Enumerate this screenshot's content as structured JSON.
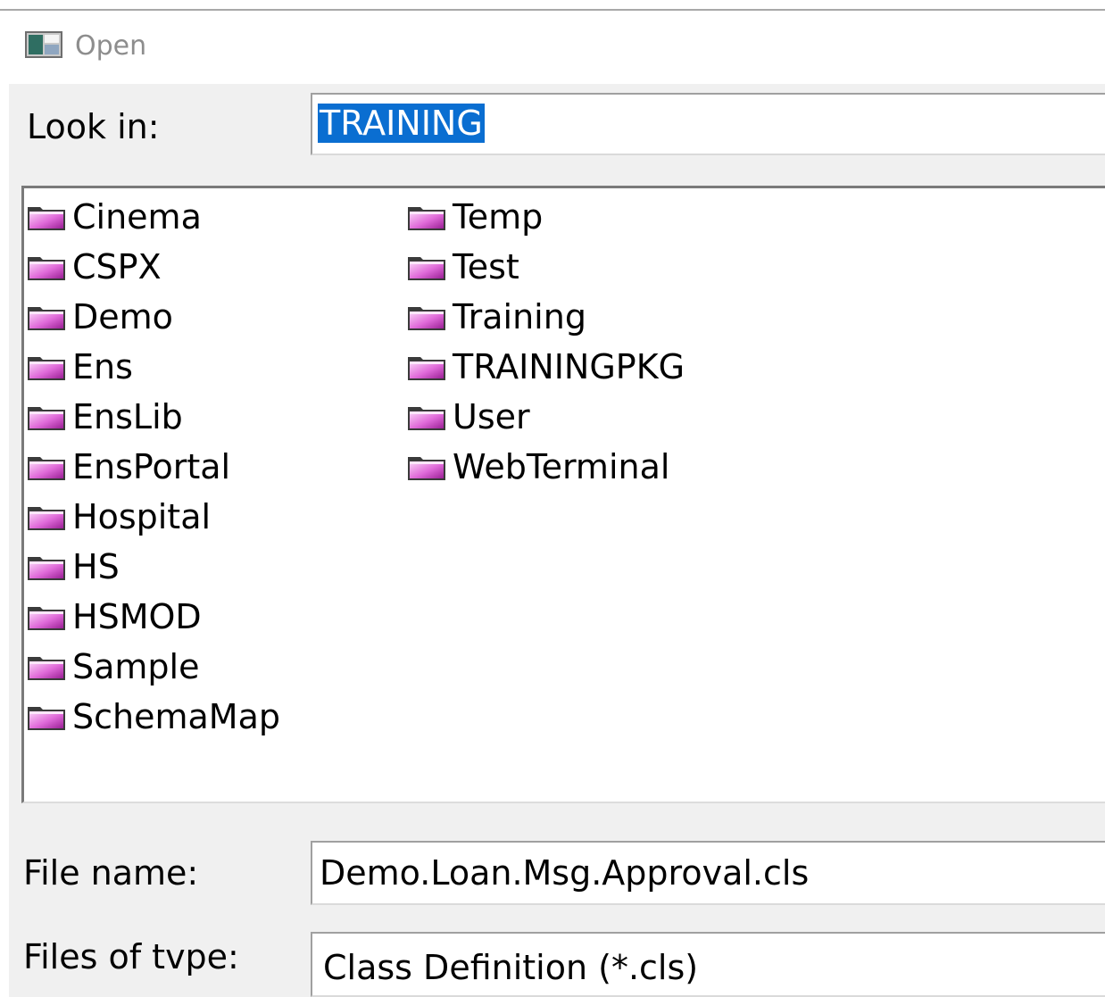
{
  "window": {
    "title": "Open",
    "icon": "window-app-icon"
  },
  "look_in": {
    "label": "Look in:",
    "value": "TRAINING"
  },
  "folders": {
    "column1": [
      "Cinema",
      "CSPX",
      "Demo",
      "Ens",
      "EnsLib",
      "EnsPortal",
      "Hospital",
      "HS",
      "HSMOD",
      "Sample",
      "SchemaMap"
    ],
    "column2": [
      "Temp",
      "Test",
      "Training",
      "TRAININGPKG",
      "User",
      "WebTerminal"
    ],
    "icon": "folder-icon"
  },
  "file_name": {
    "label": "File name:",
    "value": "Demo.Loan.Msg.Approval.cls"
  },
  "files_of_type": {
    "label": "Files of tvpe:",
    "value": "Class Definition (*.cls)"
  },
  "colors": {
    "dialog_background": "#f0f0f0",
    "selection": "#0a6ed1",
    "folder_light": "#f7c0f4",
    "folder_mid": "#d84fd4",
    "folder_dark": "#8c1e8a"
  }
}
